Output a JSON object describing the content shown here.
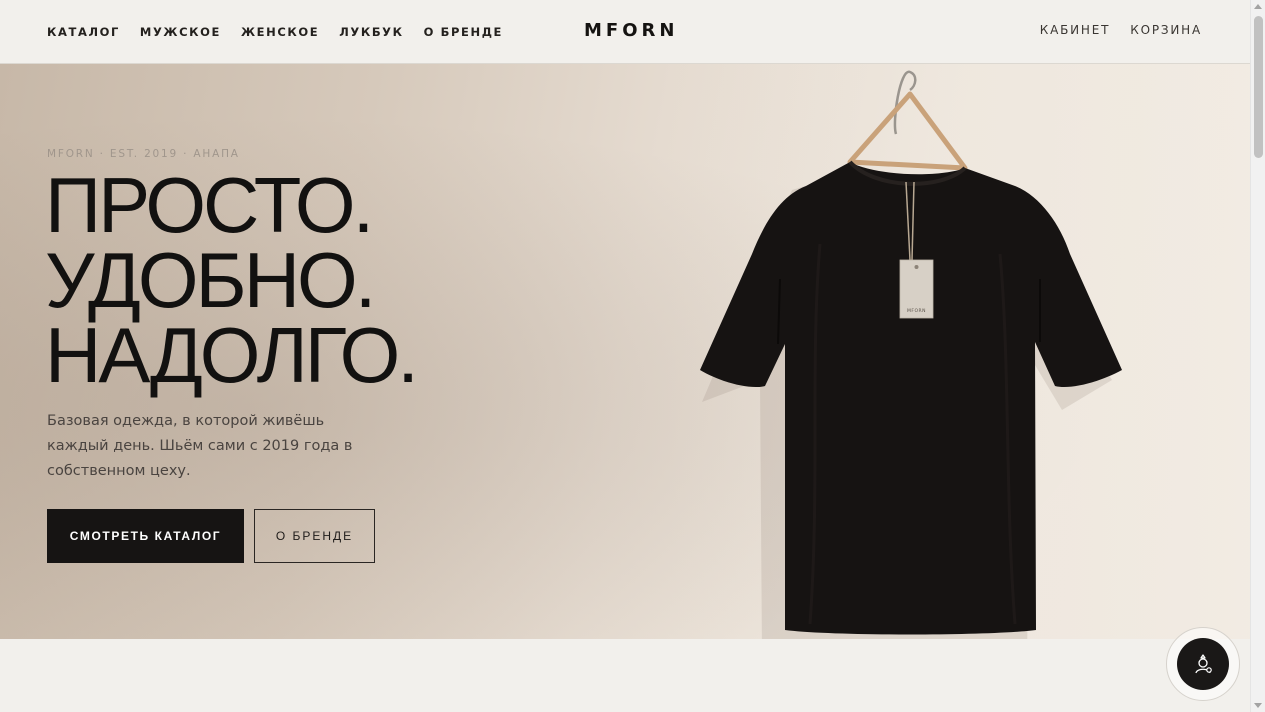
{
  "header": {
    "logo": "MFORN",
    "nav_left": [
      "КАТАЛОГ",
      "МУЖСКОЕ",
      "ЖЕНСКОЕ",
      "ЛУКБУК",
      "О БРЕНДЕ"
    ],
    "nav_right": [
      "КАБИНЕТ",
      "КОРЗИНА"
    ]
  },
  "hero": {
    "eyebrow": "MFORN · EST. 2019 · АНАПА",
    "headline": [
      "ПРОСТО.",
      "УДОБНО.",
      "НАДОЛГО."
    ],
    "subtitle": "Базовая одежда, в которой живёшь каждый день. Шьём сами с 2019 года в собственном цеху.",
    "primary_button": "СМОТРЕТЬ КАТАЛОГ",
    "secondary_button": "О БРЕНДЕ",
    "tag_label": "MFORN",
    "image_icon": "black-tshirt-on-hanger"
  },
  "chat": {
    "icon": "chat-assistant-icon"
  },
  "colors": {
    "accent": "#161413",
    "background": "#f1efeb"
  }
}
